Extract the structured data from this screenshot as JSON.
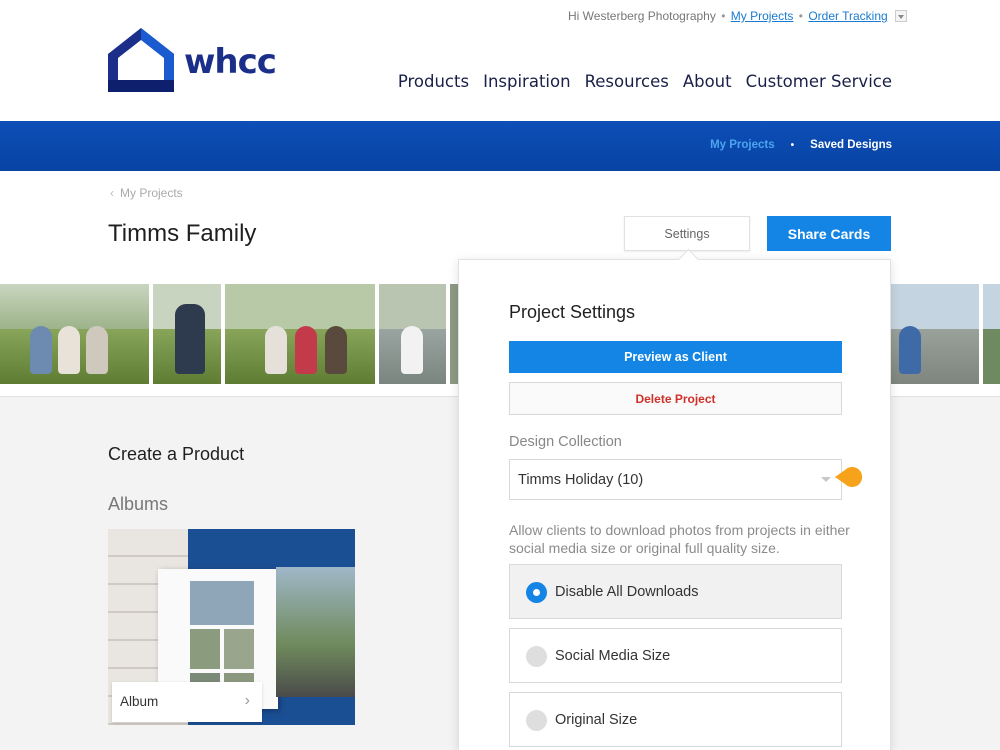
{
  "utility_bar": {
    "greeting": "Hi Westerberg Photography",
    "separator": "•",
    "my_projects_link": "My Projects",
    "order_tracking_link": "Order Tracking"
  },
  "brand": {
    "name": "whcc",
    "colors": {
      "navy": "#1b2f8a",
      "blue": "#1485e4",
      "band": "#0743a3",
      "danger": "#d0302a",
      "marker": "#f6a21a"
    }
  },
  "main_nav": [
    "Products",
    "Inspiration",
    "Resources",
    "About",
    "Customer Service"
  ],
  "sub_nav": {
    "my_projects": "My Projects",
    "separator": "•",
    "saved_designs": "Saved Designs"
  },
  "breadcrumb": {
    "back_label": "My Projects"
  },
  "project": {
    "title": "Timms Family",
    "settings_button": "Settings",
    "share_button": "Share Cards"
  },
  "content": {
    "section_title": "Create a Product",
    "category": "Albums",
    "product_card_label": "Album"
  },
  "settings_popover": {
    "title": "Project Settings",
    "preview_button": "Preview as Client",
    "delete_button": "Delete Project",
    "design_collection_label": "Design Collection",
    "design_collection_value": "Timms Holiday (10)",
    "download_help": "Allow clients to download photos from projects in either social media size or original full quality size.",
    "download_options": [
      {
        "label": "Disable All Downloads",
        "selected": true
      },
      {
        "label": "Social Media Size",
        "selected": false
      },
      {
        "label": "Original Size",
        "selected": false
      }
    ]
  }
}
